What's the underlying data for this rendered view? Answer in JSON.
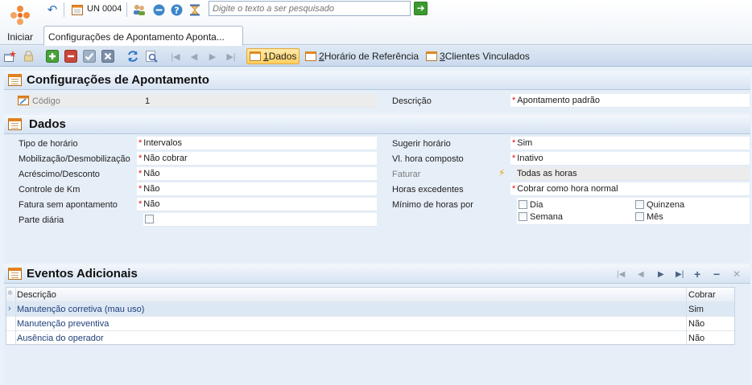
{
  "start": {
    "label": "Iniciar"
  },
  "quickbar": {
    "unit": "UN 0004",
    "search_placeholder": "Digite o texto a ser pesquisado"
  },
  "doc_tab": {
    "title": "Configurações de Apontamento Aponta..."
  },
  "tabs": [
    {
      "num": "1",
      "label": " Dados"
    },
    {
      "num": "2",
      "label": " Horário de Referência"
    },
    {
      "num": "3",
      "label": " Clientes Vinculados"
    }
  ],
  "header_section": {
    "title": "Configurações de Apontamento",
    "codigo_label": "Código",
    "codigo_value": "1",
    "descricao_label": "Descrição",
    "descricao_value": "Apontamento padrão"
  },
  "dados": {
    "title": "Dados",
    "left": [
      {
        "label": "Tipo de horário",
        "value": "Intervalos",
        "req": "*"
      },
      {
        "label": "Mobilização/Desmobilização",
        "value": "Não cobrar",
        "req": "*"
      },
      {
        "label": "Acréscimo/Desconto",
        "value": "Não",
        "req": "*"
      },
      {
        "label": "Controle de Km",
        "value": "Não",
        "req": "*"
      },
      {
        "label": "Fatura sem apontamento",
        "value": "Não",
        "req": "*"
      },
      {
        "label": "Parte diária",
        "value": ""
      }
    ],
    "right": [
      {
        "label": "Sugerir horário",
        "value": "Sim",
        "req": "*"
      },
      {
        "label": "Vl. hora composto",
        "value": "Inativo",
        "req": "*"
      },
      {
        "label": "Faturar",
        "value": "Todas as horas"
      },
      {
        "label": "Horas excedentes",
        "value": "Cobrar como hora normal",
        "req": "*"
      },
      {
        "label": "Mínimo de horas por",
        "value": ""
      }
    ],
    "minimo_options": [
      "Dia",
      "Quinzena",
      "Semana",
      "Mês"
    ]
  },
  "eventos": {
    "title": "Eventos Adicionais",
    "columns": [
      "Descrição",
      "Cobrar"
    ],
    "rows": [
      {
        "descricao": "Manutenção corretiva (mau uso)",
        "cobrar": "Sim"
      },
      {
        "descricao": "Manutenção preventiva",
        "cobrar": "Não"
      },
      {
        "descricao": "Ausência do operador",
        "cobrar": "Não"
      }
    ]
  }
}
